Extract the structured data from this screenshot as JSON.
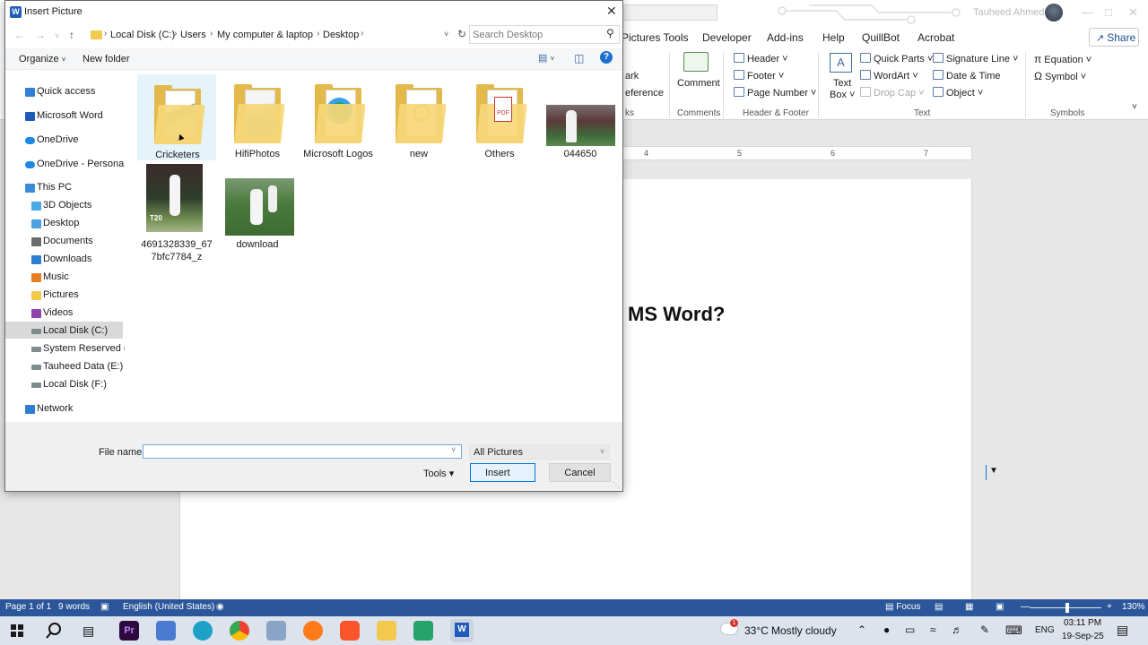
{
  "word": {
    "user_name": "Tauheed Ahmed",
    "tabs": [
      "Pictures Tools",
      "Developer",
      "Add-ins",
      "Help",
      "QuillBot",
      "Acrobat"
    ],
    "share_label": "Share",
    "ribbon": {
      "partial_links": [
        "ark",
        "eference",
        "ks"
      ],
      "comment": "Comment",
      "header": "Header",
      "footer": "Footer",
      "page_number": "Page Number",
      "text_box_line1": "Text",
      "text_box_line2": "Box",
      "quick_parts": "Quick Parts",
      "wordart": "WordArt",
      "drop_cap": "Drop Cap",
      "signature_line": "Signature Line",
      "date_time": "Date & Time",
      "object": "Object",
      "equation": "Equation",
      "symbol": "Symbol",
      "groups": [
        "Comments",
        "Header & Footer",
        "Text",
        "Symbols"
      ]
    },
    "ruler_numbers": [
      "4",
      "5",
      "6",
      "7"
    ],
    "doc_heading": "MS Word?",
    "status": {
      "page": "Page 1 of 1",
      "words": "9 words",
      "language": "English (United States)",
      "focus": "Focus",
      "zoom": "130%",
      "zoom_fraction": 0.52
    }
  },
  "taskbar": {
    "weather_temp": "33°C",
    "weather_text": "Mostly cloudy",
    "weather_badge": "1",
    "lang": "ENG",
    "time": "03:11 PM",
    "date": "19-Sep-25"
  },
  "dialog": {
    "title": "Insert Picture",
    "breadcrumbs": [
      "Local Disk (C:)",
      "Users",
      "My computer & laptop",
      "Desktop"
    ],
    "search_placeholder": "Search Desktop",
    "organize": "Organize",
    "new_folder": "New folder",
    "nav": [
      {
        "label": "Quick access",
        "icon": "star-icon",
        "color": "#2f7fd6"
      },
      {
        "label": "Microsoft Word",
        "icon": "word-icon",
        "color": "#1f5bb8"
      },
      {
        "label": "OneDrive",
        "icon": "cloud-icon",
        "color": "#1e88e5"
      },
      {
        "label": "OneDrive - Personal",
        "icon": "cloud-icon",
        "color": "#1e88e5"
      },
      {
        "label": "This PC",
        "icon": "computer-icon",
        "color": "#3b8bd8"
      },
      {
        "label": "3D Objects",
        "icon": "cube-icon",
        "color": "#48a9e6"
      },
      {
        "label": "Desktop",
        "icon": "folder-icon",
        "color": "#4aa3df"
      },
      {
        "label": "Documents",
        "icon": "folder-icon",
        "color": "#6b6b6b"
      },
      {
        "label": "Downloads",
        "icon": "download-icon",
        "color": "#2d7dd2"
      },
      {
        "label": "Music",
        "icon": "music-icon",
        "color": "#e67e22"
      },
      {
        "label": "Pictures",
        "icon": "folder-icon",
        "color": "#f2c94c"
      },
      {
        "label": "Videos",
        "icon": "video-icon",
        "color": "#8e44ad"
      },
      {
        "label": "Local Disk (C:)",
        "icon": "drive-icon",
        "color": "#7f8c8d"
      },
      {
        "label": "System Reserved (D:",
        "icon": "drive-icon",
        "color": "#7f8c8d"
      },
      {
        "label": "Tauheed Data (E:)",
        "icon": "drive-icon",
        "color": "#7f8c8d"
      },
      {
        "label": "Local Disk (F:)",
        "icon": "drive-icon",
        "color": "#7f8c8d"
      },
      {
        "label": "Network",
        "icon": "network-icon",
        "color": "#2d7dd2"
      }
    ],
    "items": [
      {
        "label": "Cricketers",
        "type": "folder"
      },
      {
        "label": "HifiPhotos",
        "type": "folder"
      },
      {
        "label": "Microsoft Logos",
        "type": "folder"
      },
      {
        "label": "new",
        "type": "folder"
      },
      {
        "label": "Others",
        "type": "folder"
      },
      {
        "label": "044650",
        "type": "image"
      },
      {
        "label": "4691328339_677bfc7784_z",
        "type": "image"
      },
      {
        "label": "download",
        "type": "image"
      }
    ],
    "file_name_label": "File name:",
    "file_name_value": "",
    "file_type": "All Pictures",
    "tools": "Tools",
    "insert": "Insert",
    "cancel": "Cancel"
  }
}
